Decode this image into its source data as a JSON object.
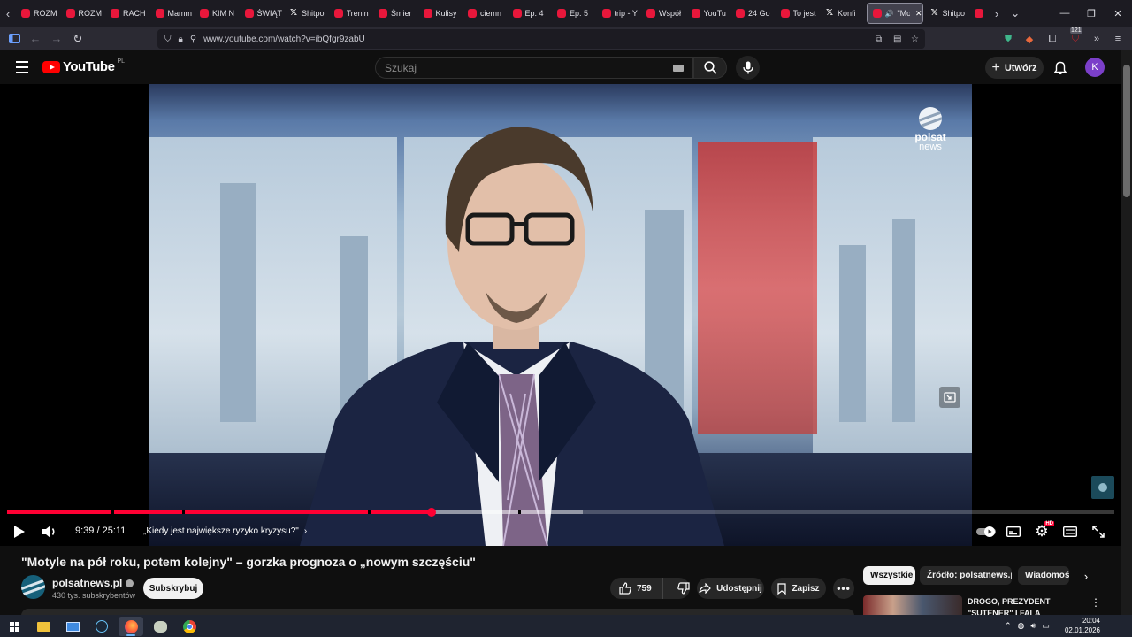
{
  "browser": {
    "tabs": [
      {
        "label": "ROZM",
        "icon": "youtube-icon"
      },
      {
        "label": "ROZM",
        "icon": "youtube-icon"
      },
      {
        "label": "RACH",
        "icon": "youtube-icon"
      },
      {
        "label": "Mamm",
        "icon": "youtube-icon"
      },
      {
        "label": "KIM N",
        "icon": "youtube-icon"
      },
      {
        "label": "ŚWIĄT",
        "icon": "youtube-icon"
      },
      {
        "label": "Shitpo",
        "icon": "x-icon"
      },
      {
        "label": "Trenin",
        "icon": "youtube-icon"
      },
      {
        "label": "Śmier",
        "icon": "youtube-icon"
      },
      {
        "label": "Kulisy",
        "icon": "youtube-icon"
      },
      {
        "label": "ciemn",
        "icon": "youtube-icon"
      },
      {
        "label": "Ep. 4",
        "icon": "youtube-icon"
      },
      {
        "label": "Ep. 5",
        "icon": "youtube-icon"
      },
      {
        "label": "trip - Y",
        "icon": "youtube-icon"
      },
      {
        "label": "Współ",
        "icon": "youtube-icon"
      },
      {
        "label": "YouTu",
        "icon": "youtube-icon"
      },
      {
        "label": "24 Go",
        "icon": "youtube-icon"
      },
      {
        "label": "To jest",
        "icon": "youtube-icon"
      },
      {
        "label": "Konfi",
        "icon": "x-icon"
      }
    ],
    "active_tab": {
      "label": "\"Mo",
      "close": "✕"
    },
    "tabs_after": [
      {
        "label": "Shitpo",
        "icon": "x-icon"
      }
    ],
    "url": "www.youtube.com/watch?v=ibQfgr9zabU",
    "extension_badge": "121"
  },
  "youtube": {
    "logo_text": "YouTube",
    "region": "PL",
    "search_placeholder": "Szukaj",
    "create_label": "Utwórz",
    "avatar_letter": "K"
  },
  "player": {
    "watermark_line1": "polsat",
    "watermark_line2": "news",
    "current_time": "9:39",
    "duration": "25:11",
    "time_separator": " / ",
    "chapter_title": "„Kiedy jest największe ryzyko kryzysu?\"",
    "progress_fraction": 0.3833,
    "buffer_fraction": 0.52,
    "chapter_marks": [
      0.094,
      0.158,
      0.326,
      0.462
    ],
    "settings_badge": "HD"
  },
  "video_info": {
    "title": "\"Motyle na pół roku, potem kolejny\" – gorzka prognoza o „nowym szczęściu\"",
    "channel_name": "polsatnews.pl",
    "subscribers": "430 tys. subskrybentów",
    "subscribe_label": "Subskrybuj",
    "likes": "759",
    "share_label": "Udostępnij",
    "save_label": "Zapisz"
  },
  "sidebar": {
    "chips": [
      "Wszystkie",
      "Źródło: polsatnews.pl",
      "Wiadomości"
    ],
    "active_chip": 0,
    "recommendation_title": "DROGO, PREZYDENT \"SUTENER\" I FALA UKRAIŃCÓ..."
  },
  "taskbar": {
    "time": "20:04",
    "date": "02.01.2026"
  },
  "colors": {
    "youtube_red": "#ff0000",
    "progress_red": "#ff0033",
    "avatar": "#7b3fc9",
    "page_bg": "#0f0f0f"
  }
}
